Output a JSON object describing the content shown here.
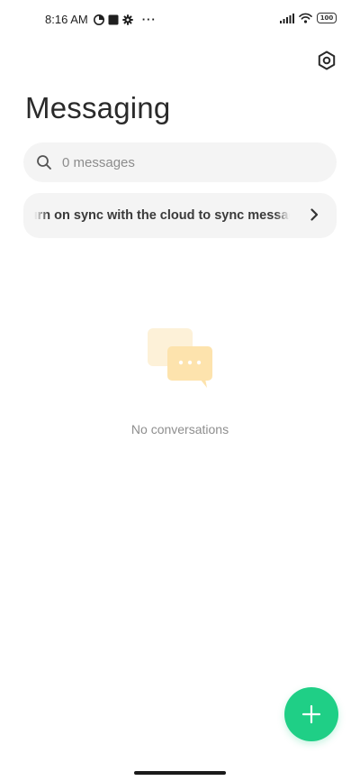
{
  "status_bar": {
    "time": "8:16 AM",
    "more": "···",
    "battery": "100"
  },
  "header": {
    "title": "Messaging"
  },
  "search": {
    "placeholder": "0 messages"
  },
  "sync_banner": {
    "text": "Turn on sync with the cloud to sync messages"
  },
  "empty_state": {
    "text": "No conversations"
  },
  "colors": {
    "accent": "#1fcf86",
    "illustration": "#fde8b8"
  },
  "icons": {
    "settings": "gear-icon",
    "search": "search-icon",
    "chevron": "chevron-right-icon",
    "fab": "plus-icon"
  }
}
